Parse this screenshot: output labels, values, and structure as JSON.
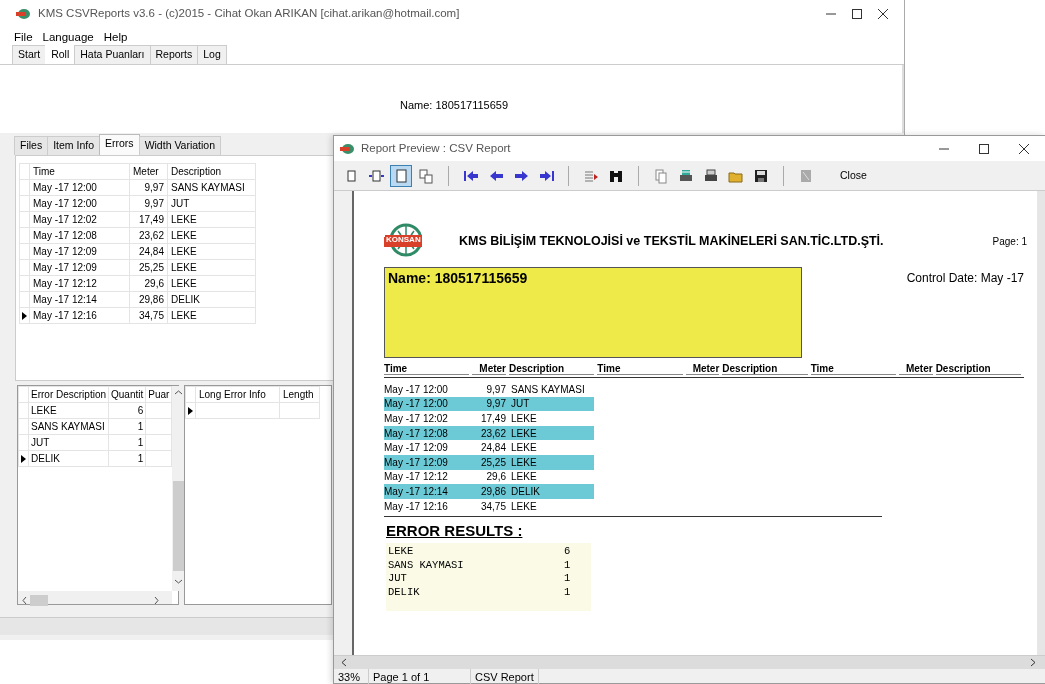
{
  "main_window": {
    "title": "KMS CSVReports v3.6 - (c)2015 - Cihat Okan ARIKAN [cihat.arikan@hotmail.com]",
    "menu": [
      "File",
      "Language",
      "Help"
    ],
    "tabs": [
      {
        "label": "Start",
        "selected": false
      },
      {
        "label": "Roll",
        "selected": true
      },
      {
        "label": "Hata Puanları",
        "selected": false
      },
      {
        "label": "Reports",
        "selected": false
      },
      {
        "label": "Log",
        "selected": false
      }
    ],
    "name_label": "Name: 180517115659",
    "sub_tabs": [
      {
        "label": "Files",
        "selected": false
      },
      {
        "label": "Item Info",
        "selected": false
      },
      {
        "label": "Errors",
        "selected": true
      },
      {
        "label": "Width Variation",
        "selected": false
      }
    ],
    "errors_table": {
      "columns": [
        "Time",
        "Meter",
        "Description"
      ],
      "rows": [
        {
          "cells": [
            "May -17 12:00",
            "9,97",
            "SANS KAYMASI"
          ],
          "current": false
        },
        {
          "cells": [
            "May -17 12:00",
            "9,97",
            "JUT"
          ],
          "current": false
        },
        {
          "cells": [
            "May -17 12:02",
            "17,49",
            "LEKE"
          ],
          "current": false
        },
        {
          "cells": [
            "May -17 12:08",
            "23,62",
            "LEKE"
          ],
          "current": false
        },
        {
          "cells": [
            "May -17 12:09",
            "24,84",
            "LEKE"
          ],
          "current": false
        },
        {
          "cells": [
            "May -17 12:09",
            "25,25",
            "LEKE"
          ],
          "current": false
        },
        {
          "cells": [
            "May -17 12:12",
            "29,6",
            "LEKE"
          ],
          "current": false
        },
        {
          "cells": [
            "May -17 12:14",
            "29,86",
            "DELIK"
          ],
          "current": false
        },
        {
          "cells": [
            "May -17 12:16",
            "34,75",
            "LEKE"
          ],
          "current": true
        }
      ]
    },
    "summary_table": {
      "columns": [
        "Error Description",
        "Quantit",
        "Puar"
      ],
      "rows": [
        {
          "cells": [
            "LEKE",
            "6"
          ],
          "current": false
        },
        {
          "cells": [
            "SANS KAYMASI",
            "1"
          ],
          "current": false
        },
        {
          "cells": [
            "JUT",
            "1"
          ],
          "current": false
        },
        {
          "cells": [
            "DELIK",
            "1"
          ],
          "current": true
        }
      ]
    },
    "detail_table": {
      "columns": [
        "Long Error Info",
        "Length"
      ],
      "rows": [
        {
          "current": true
        }
      ]
    }
  },
  "preview_window": {
    "title": "Report Preview : CSV Report",
    "toolbar": [
      {
        "kind": "page",
        "selected": false
      },
      {
        "kind": "page-width",
        "selected": false
      },
      {
        "kind": "single-page",
        "selected": true
      },
      {
        "kind": "multi-page",
        "selected": false
      },
      {
        "kind": "separator"
      },
      {
        "kind": "first",
        "selected": false
      },
      {
        "kind": "prev",
        "selected": false
      },
      {
        "kind": "next",
        "selected": false
      },
      {
        "kind": "last",
        "selected": false
      },
      {
        "kind": "separator"
      },
      {
        "kind": "outline",
        "selected": false
      },
      {
        "kind": "find",
        "selected": false
      },
      {
        "kind": "separator"
      },
      {
        "kind": "copy",
        "selected": false
      },
      {
        "kind": "setup",
        "selected": false
      },
      {
        "kind": "print",
        "selected": false
      },
      {
        "kind": "open",
        "selected": false
      },
      {
        "kind": "save",
        "selected": false
      },
      {
        "kind": "separator"
      },
      {
        "kind": "disabled",
        "selected": false
      }
    ],
    "close_label": "Close",
    "report": {
      "company": "KMS BİLİŞİM TEKNOLOJİSİ ve TEKSTİL MAKİNELERİ SAN.TİC.LTD.ŞTİ.",
      "logo_text": "KONSAN",
      "page": "Page: 1",
      "name": "Name: 180517115659",
      "control_date": "Control Date: May -17",
      "columns": [
        "Time",
        "Meter",
        "Description",
        "Time",
        "Meter",
        "Description",
        "Time",
        "Meter",
        "Description"
      ],
      "rows": [
        {
          "time": "May -17 12:00",
          "meter": "9,97",
          "description": "SANS KAYMASI",
          "highlighted": false
        },
        {
          "time": "May -17 12:00",
          "meter": "9,97",
          "description": "JUT",
          "highlighted": true
        },
        {
          "time": "May -17 12:02",
          "meter": "17,49",
          "description": "LEKE",
          "highlighted": false
        },
        {
          "time": "May -17 12:08",
          "meter": "23,62",
          "description": "LEKE",
          "highlighted": true
        },
        {
          "time": "May -17 12:09",
          "meter": "24,84",
          "description": "LEKE",
          "highlighted": false
        },
        {
          "time": "May -17 12:09",
          "meter": "25,25",
          "description": "LEKE",
          "highlighted": true
        },
        {
          "time": "May -17 12:12",
          "meter": "29,6",
          "description": "LEKE",
          "highlighted": false
        },
        {
          "time": "May -17 12:14",
          "meter": "29,86",
          "description": "DELIK",
          "highlighted": true
        },
        {
          "time": "May -17 12:16",
          "meter": "34,75",
          "description": "LEKE",
          "highlighted": false
        }
      ],
      "results_title": "ERROR RESULTS :",
      "results": [
        {
          "label": "LEKE",
          "count": "6"
        },
        {
          "label": "SANS KAYMASI",
          "count": "1"
        },
        {
          "label": "JUT",
          "count": "1"
        },
        {
          "label": "DELIK",
          "count": "1"
        }
      ]
    },
    "status": [
      "33%",
      "Page 1 of 1",
      "CSV Report"
    ]
  }
}
